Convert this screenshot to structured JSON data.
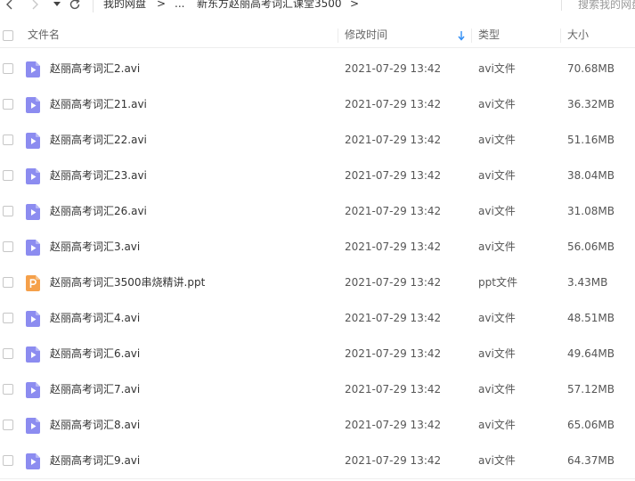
{
  "nav": {
    "breadcrumb_root": "我的网盘",
    "breadcrumb_arrow": ">",
    "breadcrumb_ellipsis": "...",
    "breadcrumb_current": "新东方赵丽高考词汇课堂3500",
    "search_placeholder": "搜索我的网盘文件"
  },
  "columns": {
    "name": "文件名",
    "modified": "修改时间",
    "type": "类型",
    "size": "大小"
  },
  "colors": {
    "video_icon": "#8c8cf0",
    "ppt_icon": "#f5a04a",
    "sort_arrow": "#2f8df5"
  },
  "files": [
    {
      "name": "赵丽高考词汇2.avi",
      "modified": "2021-07-29 13:42",
      "type": "avi文件",
      "size": "70.68MB",
      "icon": "video-file-icon"
    },
    {
      "name": "赵丽高考词汇21.avi",
      "modified": "2021-07-29 13:42",
      "type": "avi文件",
      "size": "36.32MB",
      "icon": "video-file-icon"
    },
    {
      "name": "赵丽高考词汇22.avi",
      "modified": "2021-07-29 13:42",
      "type": "avi文件",
      "size": "51.16MB",
      "icon": "video-file-icon"
    },
    {
      "name": "赵丽高考词汇23.avi",
      "modified": "2021-07-29 13:42",
      "type": "avi文件",
      "size": "38.04MB",
      "icon": "video-file-icon"
    },
    {
      "name": "赵丽高考词汇26.avi",
      "modified": "2021-07-29 13:42",
      "type": "avi文件",
      "size": "31.08MB",
      "icon": "video-file-icon"
    },
    {
      "name": "赵丽高考词汇3.avi",
      "modified": "2021-07-29 13:42",
      "type": "avi文件",
      "size": "56.06MB",
      "icon": "video-file-icon"
    },
    {
      "name": "赵丽高考词汇3500串烧精讲.ppt",
      "modified": "2021-07-29 13:42",
      "type": "ppt文件",
      "size": "3.43MB",
      "icon": "ppt-file-icon"
    },
    {
      "name": "赵丽高考词汇4.avi",
      "modified": "2021-07-29 13:42",
      "type": "avi文件",
      "size": "48.51MB",
      "icon": "video-file-icon"
    },
    {
      "name": "赵丽高考词汇6.avi",
      "modified": "2021-07-29 13:42",
      "type": "avi文件",
      "size": "49.64MB",
      "icon": "video-file-icon"
    },
    {
      "name": "赵丽高考词汇7.avi",
      "modified": "2021-07-29 13:42",
      "type": "avi文件",
      "size": "57.12MB",
      "icon": "video-file-icon"
    },
    {
      "name": "赵丽高考词汇8.avi",
      "modified": "2021-07-29 13:42",
      "type": "avi文件",
      "size": "65.06MB",
      "icon": "video-file-icon"
    },
    {
      "name": "赵丽高考词汇9.avi",
      "modified": "2021-07-29 13:42",
      "type": "avi文件",
      "size": "64.37MB",
      "icon": "video-file-icon"
    }
  ]
}
